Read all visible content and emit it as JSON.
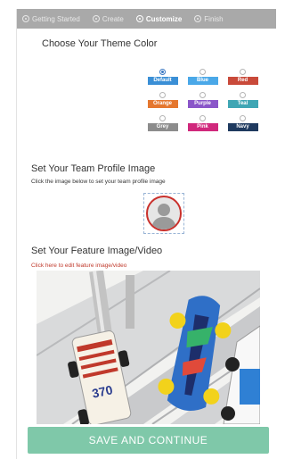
{
  "wizard": {
    "steps": [
      {
        "label": "Getting Started",
        "icon": "circle-step-icon",
        "active": false
      },
      {
        "label": "Create",
        "icon": "circle-step-icon",
        "active": false
      },
      {
        "label": "Customize",
        "icon": "circle-step-icon",
        "active": true
      },
      {
        "label": "Finish",
        "icon": "circle-step-icon",
        "active": false
      }
    ]
  },
  "theme": {
    "title": "Choose Your Theme Color",
    "selected": "Default",
    "options": [
      {
        "label": "Default",
        "color": "#3a8fd6"
      },
      {
        "label": "Blue",
        "color": "#4aa8e8"
      },
      {
        "label": "Red",
        "color": "#c94a3a"
      },
      {
        "label": "Orange",
        "color": "#e5772f"
      },
      {
        "label": "Purple",
        "color": "#8a56c9"
      },
      {
        "label": "Teal",
        "color": "#3fa6b4"
      },
      {
        "label": "Grey",
        "color": "#8c8c8c"
      },
      {
        "label": "Pink",
        "color": "#d0287c"
      },
      {
        "label": "Navy",
        "color": "#1f3a5f"
      }
    ]
  },
  "profile": {
    "title": "Set Your Team Profile Image",
    "subtitle": "Click the image below to set your team profile image",
    "avatar_icon": "person-silhouette-icon"
  },
  "feature": {
    "title": "Set Your Feature Image/Video",
    "link": "Click here to edit feature image/video",
    "image_number": "370"
  },
  "actions": {
    "save_label": "SAVE AND CONTINUE",
    "save_color": "#7fc8a9"
  }
}
